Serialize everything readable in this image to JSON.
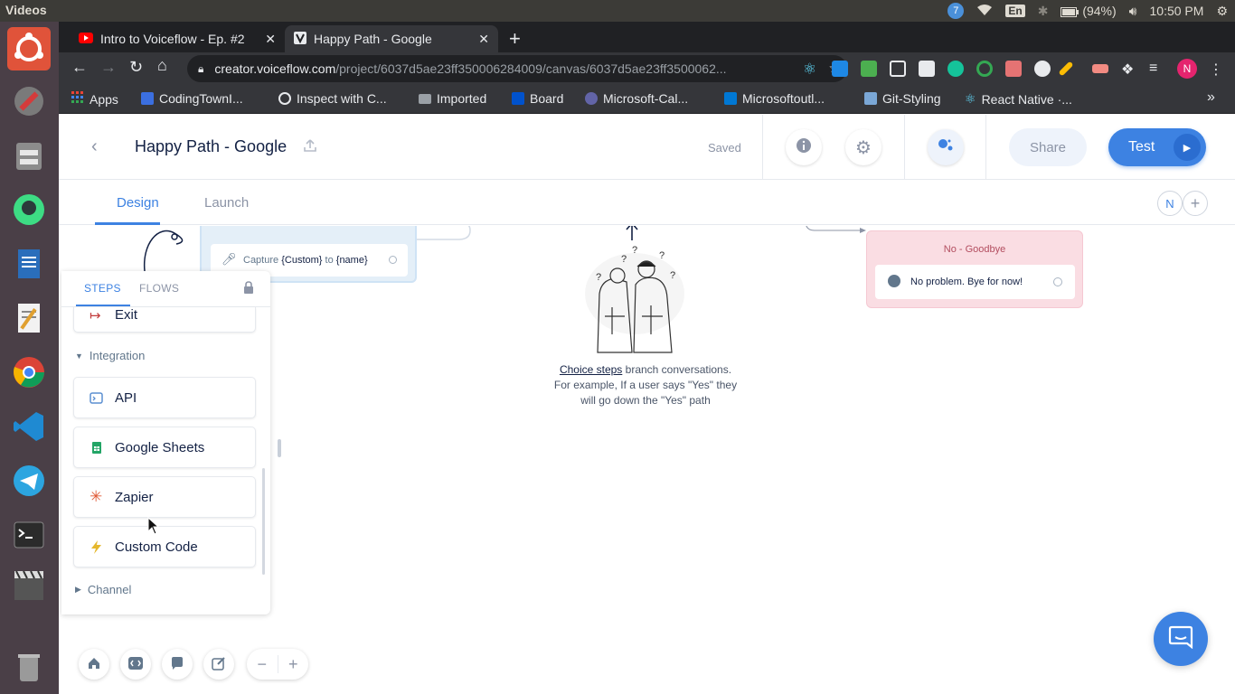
{
  "os": {
    "app_name": "Videos",
    "tray": {
      "notification_count": "7",
      "keyboard": "En",
      "battery": "(94%)",
      "time": "10:50 PM"
    }
  },
  "browser": {
    "tabs": [
      {
        "title": "Intro to Voiceflow - Ep. #2",
        "favicon": "youtube-icon"
      },
      {
        "title": "Happy Path - Google",
        "favicon": "voiceflow-icon",
        "active": true
      }
    ],
    "url": {
      "domain": "creator.voiceflow.com",
      "path": "/project/6037d5ae23ff350006284009/canvas/6037d5ae23ff3500062..."
    },
    "profile_initial": "N",
    "bookmarks": [
      {
        "label": "Apps",
        "icon": "apps-grid-icon"
      },
      {
        "label": "CodingTownI...",
        "icon": "codingtown-icon"
      },
      {
        "label": "Inspect with C...",
        "icon": "globe-icon"
      },
      {
        "label": "Imported",
        "icon": "folder-icon"
      },
      {
        "label": "Board",
        "icon": "board-icon"
      },
      {
        "label": "Microsoft-Cal...",
        "icon": "teams-icon"
      },
      {
        "label": "Microsoftoutl...",
        "icon": "outlook-icon"
      },
      {
        "label": "Git-Styling",
        "icon": "git-icon"
      },
      {
        "label": "React Native ·...",
        "icon": "react-icon"
      }
    ]
  },
  "app": {
    "project_title": "Happy Path - Google",
    "saved_label": "Saved",
    "share_label": "Share",
    "test_label": "Test",
    "tabs": {
      "design": "Design",
      "launch": "Launch"
    },
    "collaborator_initial": "N",
    "accent_color": "#3d82e2"
  },
  "canvas": {
    "capture_block": {
      "prefix": "Capture",
      "slot": "{Custom}",
      "middle": "to",
      "variable": "{name}"
    },
    "goodbye_block": {
      "title": "No - Goodbye",
      "speak_text": "No problem. Bye for now!"
    },
    "choice_hint": {
      "link": "Choice steps",
      "line1": " branch conversations.",
      "line2": "For example, If a user says \"Yes\" they will go down the \"Yes\" path"
    }
  },
  "steps_panel": {
    "tabs": {
      "steps": "STEPS",
      "flows": "FLOWS"
    },
    "exit_label": "Exit",
    "integration_section": "Integration",
    "items": [
      {
        "label": "API",
        "icon": "api-icon"
      },
      {
        "label": "Google Sheets",
        "icon": "google-sheets-icon"
      },
      {
        "label": "Zapier",
        "icon": "zapier-icon"
      },
      {
        "label": "Custom Code",
        "icon": "lightning-icon"
      }
    ],
    "channel_section": "Channel"
  }
}
